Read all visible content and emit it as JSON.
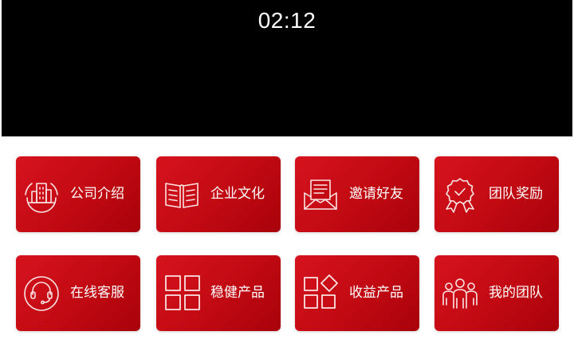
{
  "player": {
    "time": "02:12"
  },
  "menu": {
    "items": [
      {
        "label": "公司介绍",
        "icon": "building-icon"
      },
      {
        "label": "企业文化",
        "icon": "book-icon"
      },
      {
        "label": "邀请好友",
        "icon": "envelope-icon"
      },
      {
        "label": "团队奖励",
        "icon": "award-ribbon-icon"
      },
      {
        "label": "在线客服",
        "icon": "headset-icon"
      },
      {
        "label": "稳健产品",
        "icon": "grid-icon"
      },
      {
        "label": "收益产品",
        "icon": "diamond-grid-icon"
      },
      {
        "label": "我的团队",
        "icon": "group-icon"
      }
    ]
  },
  "colors": {
    "tile": "#c80c14",
    "video_background": "#000000",
    "page_background": "#ffffff"
  }
}
